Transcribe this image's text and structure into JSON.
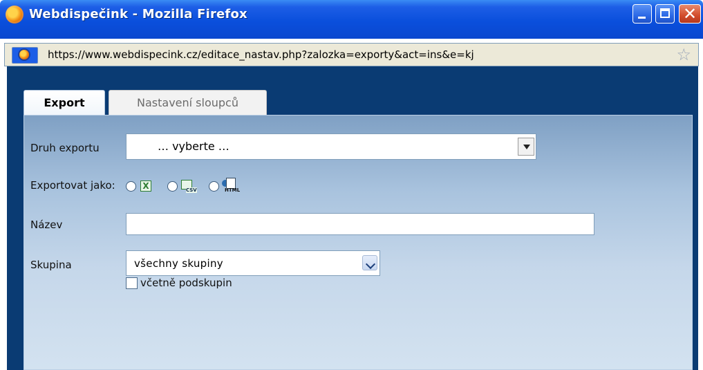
{
  "window": {
    "title": "Webdispečink - Mozilla Firefox",
    "url": "https://www.webdispecink.cz/editace_nastav.php?zalozka=exporty&act=ins&e=kj"
  },
  "tabs": [
    {
      "label": "Export",
      "active": true
    },
    {
      "label": "Nastavení sloupců",
      "active": false
    }
  ],
  "form": {
    "druh_exportu": {
      "label": "Druh exportu",
      "value": "… vyberte …"
    },
    "exportovat_jako": {
      "label": "Exportovat jako:",
      "options": [
        {
          "icon": "excel-icon",
          "selected": false
        },
        {
          "icon": "csv-icon",
          "selected": false
        },
        {
          "icon": "html-icon",
          "selected": false
        }
      ]
    },
    "nazev": {
      "label": "Název",
      "value": ""
    },
    "skupina": {
      "label": "Skupina",
      "value": "všechny skupiny"
    },
    "vcetne_podskupin": {
      "label": "včetně podskupin",
      "checked": false
    }
  }
}
